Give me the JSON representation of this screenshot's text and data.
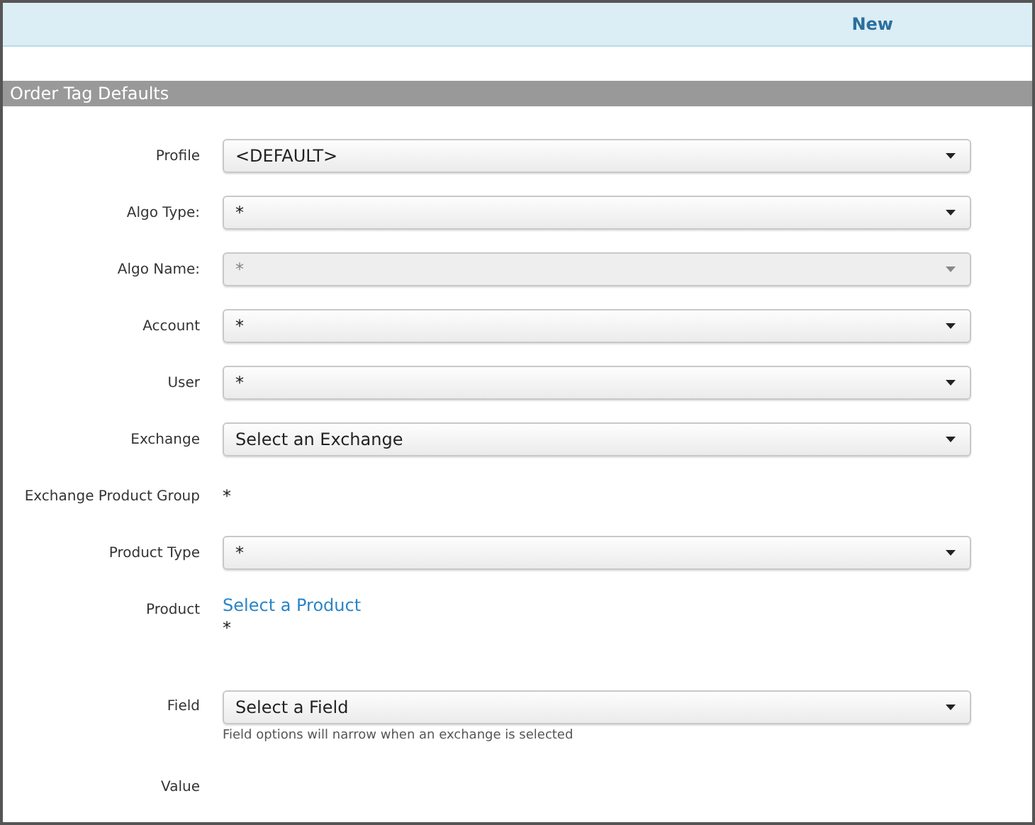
{
  "header": {
    "action": "New"
  },
  "section": {
    "title": "Order Tag Defaults"
  },
  "rows": [
    {
      "kind": "select",
      "label": "Profile",
      "value": "<DEFAULT>",
      "disabled": false
    },
    {
      "kind": "select",
      "label": "Algo Type:",
      "value": "*",
      "disabled": false
    },
    {
      "kind": "select",
      "label": "Algo Name:",
      "value": "*",
      "disabled": true
    },
    {
      "kind": "select",
      "label": "Account",
      "value": "*",
      "disabled": false
    },
    {
      "kind": "select",
      "label": "User",
      "value": "*",
      "disabled": false
    },
    {
      "kind": "select",
      "label": "Exchange",
      "value": "Select an Exchange",
      "disabled": false
    },
    {
      "kind": "static",
      "label": "Exchange Product Group",
      "value": "*"
    },
    {
      "kind": "select",
      "label": "Product Type",
      "value": "*",
      "disabled": false
    },
    {
      "kind": "link",
      "label": "Product",
      "link": "Select a Product",
      "value": "*"
    },
    {
      "kind": "select",
      "label": "Field",
      "value": "Select a Field",
      "disabled": false,
      "hint": "Field options will narrow when an exchange is selected"
    },
    {
      "kind": "empty",
      "label": "Value"
    }
  ]
}
